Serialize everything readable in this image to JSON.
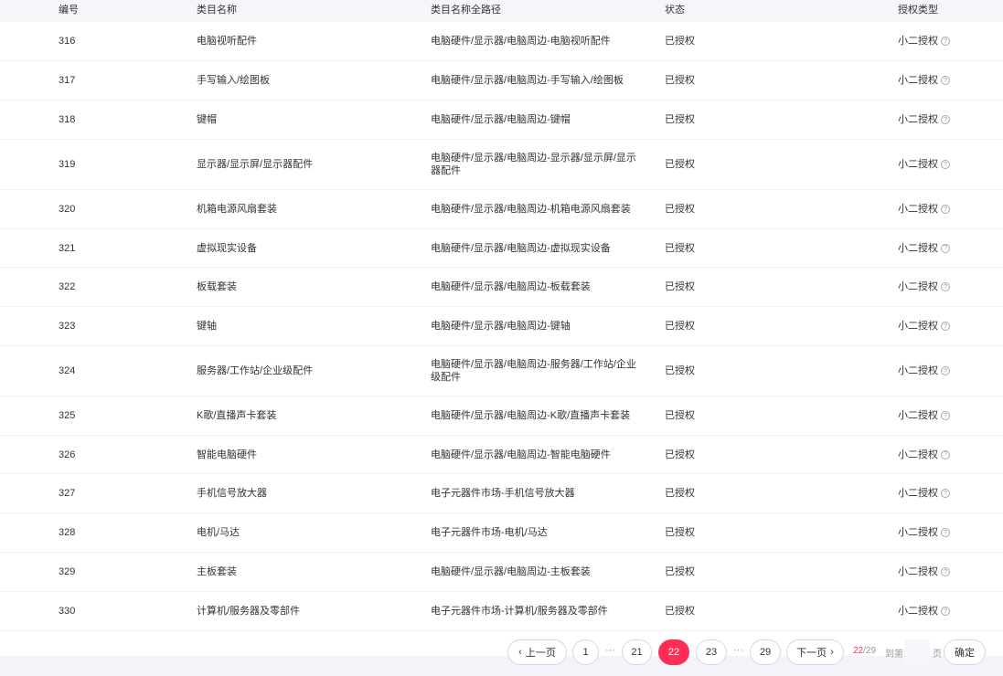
{
  "table": {
    "headers": {
      "id": "编号",
      "name": "类目名称",
      "path": "类目名称全路径",
      "status": "状态",
      "auth_type": "授权类型"
    },
    "rows": [
      {
        "id": "316",
        "name": "电脑视听配件",
        "path": "电脑硬件/显示器/电脑周边-电脑视听配件",
        "status": "已授权",
        "auth_type": "小二授权"
      },
      {
        "id": "317",
        "name": "手写输入/绘图板",
        "path": "电脑硬件/显示器/电脑周边-手写输入/绘图板",
        "status": "已授权",
        "auth_type": "小二授权"
      },
      {
        "id": "318",
        "name": "键帽",
        "path": "电脑硬件/显示器/电脑周边-键帽",
        "status": "已授权",
        "auth_type": "小二授权"
      },
      {
        "id": "319",
        "name": "显示器/显示屏/显示器配件",
        "path": "电脑硬件/显示器/电脑周边-显示器/显示屏/显示器配件",
        "status": "已授权",
        "auth_type": "小二授权"
      },
      {
        "id": "320",
        "name": "机箱电源风扇套装",
        "path": "电脑硬件/显示器/电脑周边-机箱电源风扇套装",
        "status": "已授权",
        "auth_type": "小二授权"
      },
      {
        "id": "321",
        "name": "虚拟现实设备",
        "path": "电脑硬件/显示器/电脑周边-虚拟现实设备",
        "status": "已授权",
        "auth_type": "小二授权"
      },
      {
        "id": "322",
        "name": "板载套装",
        "path": "电脑硬件/显示器/电脑周边-板载套装",
        "status": "已授权",
        "auth_type": "小二授权"
      },
      {
        "id": "323",
        "name": "键轴",
        "path": "电脑硬件/显示器/电脑周边-键轴",
        "status": "已授权",
        "auth_type": "小二授权"
      },
      {
        "id": "324",
        "name": "服务器/工作站/企业级配件",
        "path": "电脑硬件/显示器/电脑周边-服务器/工作站/企业级配件",
        "status": "已授权",
        "auth_type": "小二授权"
      },
      {
        "id": "325",
        "name": "K歌/直播声卡套装",
        "path": "电脑硬件/显示器/电脑周边-K歌/直播声卡套装",
        "status": "已授权",
        "auth_type": "小二授权"
      },
      {
        "id": "326",
        "name": "智能电脑硬件",
        "path": "电脑硬件/显示器/电脑周边-智能电脑硬件",
        "status": "已授权",
        "auth_type": "小二授权"
      },
      {
        "id": "327",
        "name": "手机信号放大器",
        "path": "电子元器件市场-手机信号放大器",
        "status": "已授权",
        "auth_type": "小二授权"
      },
      {
        "id": "328",
        "name": "电机/马达",
        "path": "电子元器件市场-电机/马达",
        "status": "已授权",
        "auth_type": "小二授权"
      },
      {
        "id": "329",
        "name": "主板套装",
        "path": "电脑硬件/显示器/电脑周边-主板套装",
        "status": "已授权",
        "auth_type": "小二授权"
      },
      {
        "id": "330",
        "name": "计算机/服务器及零部件",
        "path": "电子元器件市场-计算机/服务器及零部件",
        "status": "已授权",
        "auth_type": "小二授权"
      }
    ]
  },
  "pagination": {
    "prev_label": "上一页",
    "next_label": "下一页",
    "pages": [
      "1",
      "21",
      "22",
      "23",
      "29"
    ],
    "ellipsis": "···",
    "current_page": "22",
    "total_pages": "/29",
    "goto_label": "到第",
    "page_unit": "页",
    "confirm_label": "确定",
    "accent_color": "#ff2e55"
  },
  "icons": {
    "auth_help": "question-circle-icon",
    "prev": "chevron-left-icon",
    "next": "chevron-right-icon"
  }
}
